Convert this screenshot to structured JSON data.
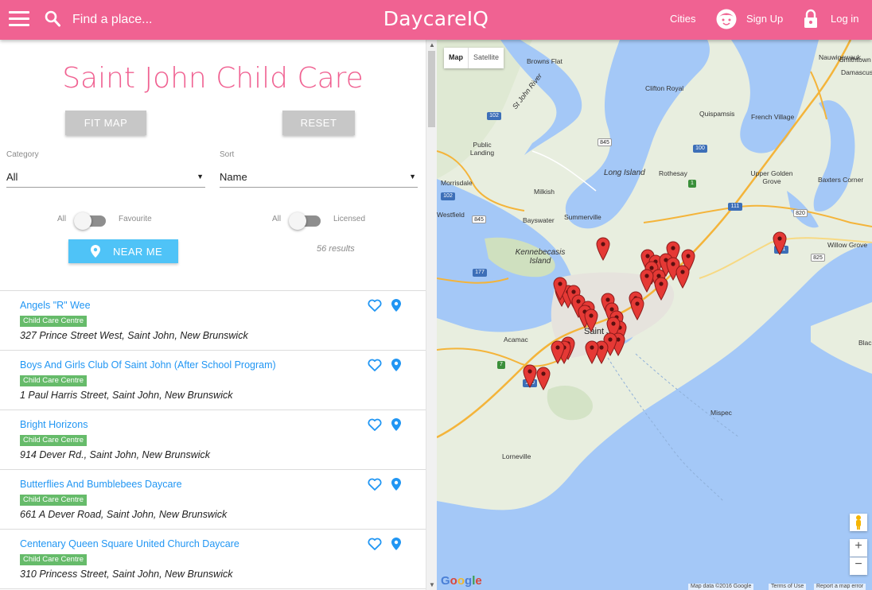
{
  "header": {
    "search_placeholder": "Find a place...",
    "brand": "DaycareIQ",
    "cities": "Cities",
    "sign_up": "Sign Up",
    "log_in": "Log in"
  },
  "panel": {
    "title": "Saint John Child Care",
    "fit_map": "FIT MAP",
    "reset": "RESET",
    "category_label": "Category",
    "category_value": "All",
    "sort_label": "Sort",
    "sort_value": "Name",
    "toggle1_left": "All",
    "toggle1_right": "Favourite",
    "toggle2_left": "All",
    "toggle2_right": "Licensed",
    "near_me": "NEAR ME",
    "results": "56 results"
  },
  "listings": [
    {
      "name": "Angels \"R\" Wee",
      "badge": "Child Care Centre",
      "address": "327 Prince Street West, Saint John, New Brunswick"
    },
    {
      "name": "Boys And Girls Club Of Saint John (After School Program)",
      "badge": "Child Care Centre",
      "address": "1 Paul Harris Street, Saint John, New Brunswick"
    },
    {
      "name": "Bright Horizons",
      "badge": "Child Care Centre",
      "address": "914 Dever Rd., Saint John, New Brunswick"
    },
    {
      "name": "Butterflies And Bumblebees Daycare",
      "badge": "Child Care Centre",
      "address": "661 A Dever Road, Saint John, New Brunswick"
    },
    {
      "name": "Centenary Queen Square United Church Daycare",
      "badge": "Child Care Centre",
      "address": "310 Princess Street, Saint John, New Brunswick"
    }
  ],
  "map": {
    "type_map": "Map",
    "type_satellite": "Satellite",
    "labels": {
      "browns_flat": "Browns Flat",
      "nauwigewauk": "Nauwigewauk",
      "smithtown": "Smithtown",
      "damascus": "Damascus",
      "clifton_royal": "Clifton Royal",
      "saint_john_river": "St John River",
      "quispamsis": "Quispamsis",
      "french_village": "French Village",
      "public_landing": "Public Landing",
      "long_island": "Long Island",
      "rothesay": "Rothesay",
      "upper_golden_grove": "Upper Golden Grove",
      "morrisdale": "Morrisdale",
      "milkish": "Milkish",
      "baxters_corner": "Baxters Corner",
      "westfield": "Westfield",
      "bayswater": "Bayswater",
      "summerville": "Summerville",
      "kennebecasis_island": "Kennebecasis Island",
      "willow_grove": "Willow Grove",
      "saint_john": "Saint John",
      "acamac": "Acamac",
      "black_river": "Black",
      "mispec": "Mispec",
      "lorneville": "Lorneville"
    },
    "shields": [
      "102",
      "845",
      "100",
      "1",
      "102",
      "845",
      "111",
      "820",
      "177",
      "825",
      "7",
      "100",
      "111"
    ],
    "marker_color": "#e53935",
    "attribution": "Map data ©2016 Google",
    "terms": "Terms of Use",
    "report": "Report a map error"
  },
  "colors": {
    "brand_pink": "#f06292",
    "link_blue": "#2196f3",
    "badge_green": "#66bb6a",
    "near_me_blue": "#4fc3f7"
  }
}
